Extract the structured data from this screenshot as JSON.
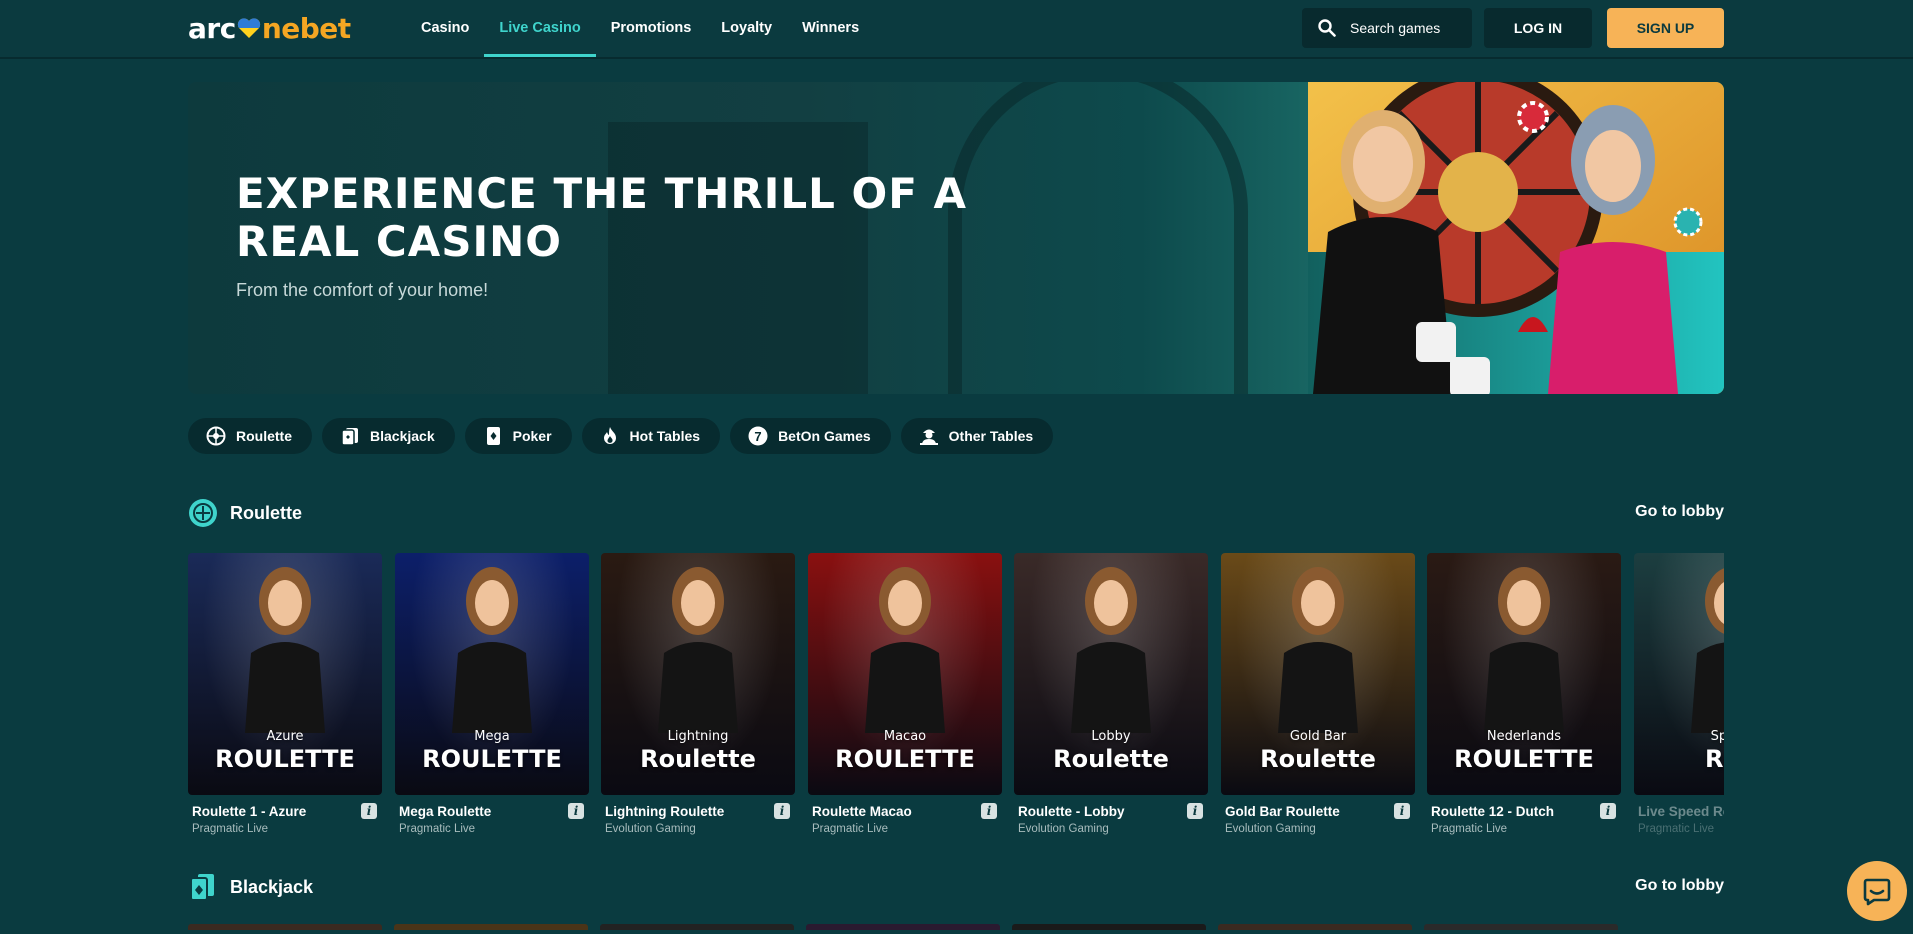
{
  "header": {
    "logo_left": "arc",
    "logo_right": "nebet",
    "nav": [
      "Casino",
      "Live Casino",
      "Promotions",
      "Loyalty",
      "Winners"
    ],
    "active_nav": "Live Casino",
    "search_placeholder": "Search games",
    "login_label": "LOG IN",
    "signup_label": "SIGN UP"
  },
  "hero": {
    "title": "EXPERIENCE THE THRILL OF A REAL CASINO",
    "subtitle": "From the comfort of your home!"
  },
  "categories": [
    {
      "label": "Roulette",
      "icon": "roulette-icon"
    },
    {
      "label": "Blackjack",
      "icon": "cards-icon"
    },
    {
      "label": "Poker",
      "icon": "poker-icon"
    },
    {
      "label": "Hot Tables",
      "icon": "flame-icon"
    },
    {
      "label": "BetOn Games",
      "icon": "seven-icon"
    },
    {
      "label": "Other Tables",
      "icon": "dealer-icon"
    }
  ],
  "sections": {
    "roulette": {
      "title": "Roulette",
      "lobby_label": "Go to lobby",
      "games": [
        {
          "name": "Roulette 1 - Azure",
          "provider": "Pragmatic Live",
          "brand_top": "Azure",
          "brand": "ROULETTE",
          "bg": "#1a2a58"
        },
        {
          "name": "Mega Roulette",
          "provider": "Pragmatic Live",
          "brand_top": "Mega",
          "brand": "ROULETTE",
          "bg": "#0c1f6a"
        },
        {
          "name": "Lightning Roulette",
          "provider": "Evolution Gaming",
          "brand_top": "Lightning",
          "brand": "Roulette",
          "bg": "#2a1a12"
        },
        {
          "name": "Roulette Macao",
          "provider": "Pragmatic Live",
          "brand_top": "Macao",
          "brand": "ROULETTE",
          "bg": "#8a1010"
        },
        {
          "name": "Roulette - Lobby",
          "provider": "Evolution Gaming",
          "brand_top": "Lobby",
          "brand": "Roulette",
          "bg": "#3a2a28"
        },
        {
          "name": "Gold Bar Roulette",
          "provider": "Evolution Gaming",
          "brand_top": "Gold Bar",
          "brand": "Roulette",
          "bg": "#6a4a18"
        },
        {
          "name": "Roulette 12 - Dutch",
          "provider": "Pragmatic Live",
          "brand_top": "Nederlands",
          "brand": "ROULETTE",
          "bg": "#2a1a14"
        },
        {
          "name": "Live Speed Ro",
          "provider": "Pragmatic Live",
          "brand_top": "Speed",
          "brand": "Rou",
          "bg": "#1c3e40"
        }
      ]
    },
    "blackjack": {
      "title": "Blackjack",
      "lobby_label": "Go to lobby"
    }
  },
  "colors": {
    "background": "#0a3b40",
    "accent": "#3fd4cc",
    "signup": "#f7b357"
  }
}
